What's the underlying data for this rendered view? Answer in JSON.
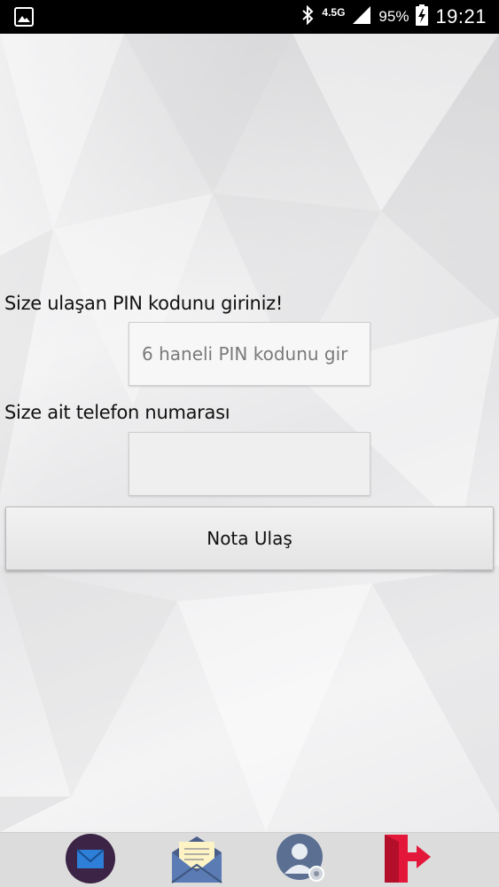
{
  "status_bar": {
    "network": "4.5G",
    "battery": "95%",
    "time": "19:21",
    "icons": [
      "gallery-icon",
      "bluetooth-icon",
      "signal-icon",
      "battery-charging-icon"
    ]
  },
  "form": {
    "pin_label": "Size ulaşan PIN kodunu giriniz!",
    "pin_placeholder": "6 haneli PIN kodunu gir",
    "pin_value": "",
    "phone_label": "Size ait telefon numarası",
    "phone_value": "",
    "submit_label": "Nota Ulaş"
  },
  "bottom_nav": {
    "items": [
      "mail-icon",
      "open-letter-icon",
      "user-settings-icon",
      "logout-icon"
    ]
  },
  "colors": {
    "mail_circle": "#3b2445",
    "mail_envelope": "#2d7fd8",
    "logout": "#e3173a"
  }
}
